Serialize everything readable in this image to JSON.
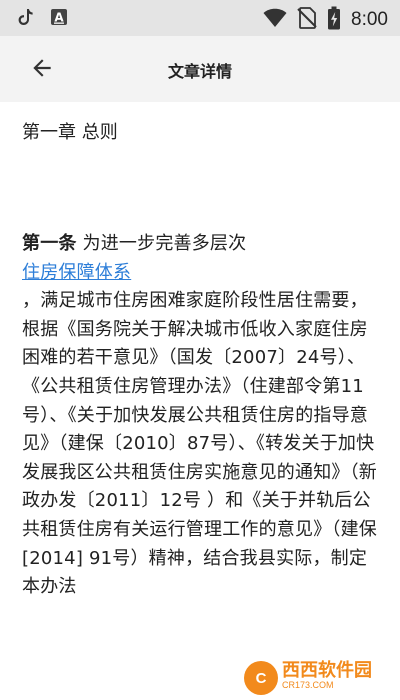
{
  "status_bar": {
    "icons": [
      "tiktok-icon",
      "text-app-icon",
      "wifi-icon",
      "no-sim-icon",
      "battery-icon"
    ],
    "time": "8:00"
  },
  "app_bar": {
    "back_icon": "arrow-left-icon",
    "title": "文章详情"
  },
  "content": {
    "chapter_title": "第一章 总则",
    "article_lead": "第一条",
    "article_intro": " 为进一步完善多层次",
    "article_link": "住房保障体系",
    "article_body": "，满足城市住房困难家庭阶段性居住需要，根据《国务院关于解决城市低收入家庭住房困难的若干意见》（国发〔2007〕24号）、《公共租赁住房管理办法》（住建部令第11号）、《关于加快发展公共租赁住房的指导意见》（建保〔2010〕87号）、《转发关于加快发展我区公共租赁住房实施意见的通知》（新政办发〔2011〕12号 ）和《关于并轨后公共租赁住房有关运行管理工作的意见》（建保[2014] 91号）精神，结合我县实际，制定本办法"
  },
  "watermark": {
    "logo_letter": "C",
    "brand": "西西软件园",
    "url": "CR173.COM"
  },
  "colors": {
    "status_bar_bg": "#e4e4e4",
    "app_bar_bg": "#f3f3f3",
    "link": "#2d7ed8",
    "text": "#222222",
    "watermark": "#f28a1c"
  }
}
